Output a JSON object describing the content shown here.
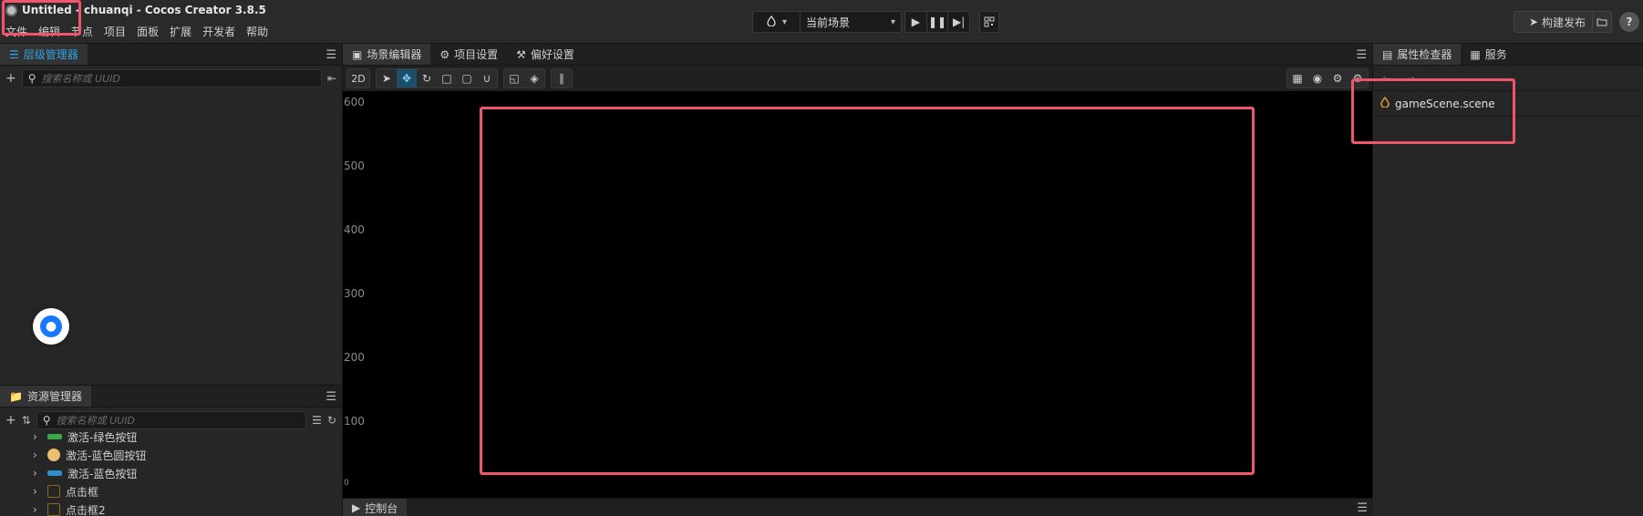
{
  "window": {
    "title": "Untitled - chuanqi - Cocos Creator 3.8.5",
    "menu": [
      "文件",
      "编辑",
      "节点",
      "项目",
      "面板",
      "扩展",
      "开发者",
      "帮助"
    ]
  },
  "topbar": {
    "scene_label": "当前场景",
    "build_label": "构建发布",
    "help_label": "?"
  },
  "hierarchy": {
    "tab_label": "层级管理器",
    "search_placeholder": "搜索名称或 UUID"
  },
  "assets": {
    "tab_label": "资源管理器",
    "search_placeholder": "搜索名称或 UUID",
    "items": [
      {
        "label": "激活-绿色按钮",
        "color": "#3aa84a"
      },
      {
        "label": "激活-蓝色圆按钮",
        "color": "#e8c070"
      },
      {
        "label": "激活-蓝色按钮",
        "color": "#2f8fc8"
      },
      {
        "label": "点击框",
        "color": "#8a6a20"
      },
      {
        "label": "点击框2",
        "color": "#8a6a20"
      }
    ]
  },
  "scene_editor": {
    "tabs": [
      "场景编辑器",
      "项目设置",
      "偏好设置"
    ],
    "mode_label": "2D",
    "y_axis_labels": [
      "600",
      "500",
      "400",
      "300",
      "200",
      "100",
      "0"
    ]
  },
  "console": {
    "tab_label": "控制台"
  },
  "inspector": {
    "tabs": [
      "属性检查器",
      "服务"
    ],
    "file_name": "gameScene.scene"
  },
  "colors": {
    "accent": "#2fa4e7",
    "highlight": "#f0566b"
  }
}
